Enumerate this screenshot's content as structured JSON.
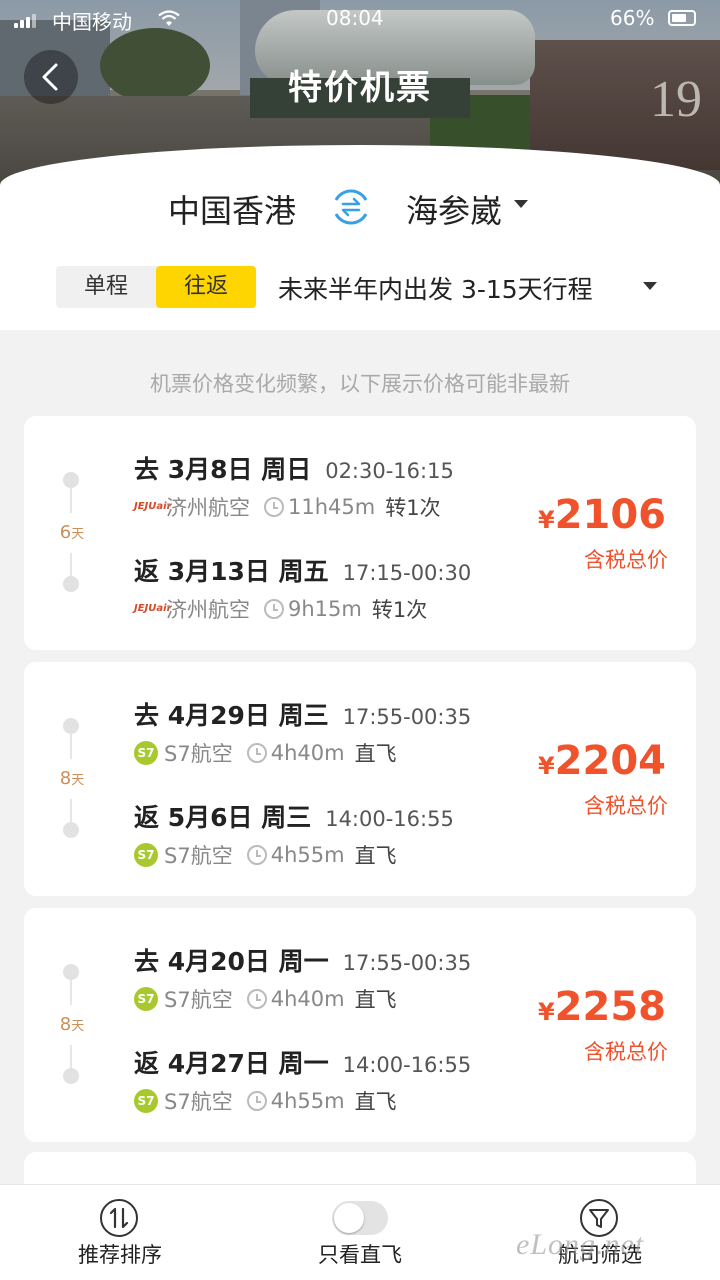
{
  "status_bar": {
    "carrier": "中国移动",
    "time": "08:04",
    "battery": "66%"
  },
  "header": {
    "title": "特价机票"
  },
  "route": {
    "from": "中国香港",
    "to": "海参崴"
  },
  "trip_type": {
    "one_way": "单程",
    "round_trip": "往返",
    "selected": "往返"
  },
  "date_filter": "未来半年内出发 3-15天行程",
  "notice": "机票价格变化频繁，以下展示价格可能非最新",
  "cards": [
    {
      "days": "6",
      "days_unit": "天",
      "out": {
        "date": "去 3月8日 周日",
        "time": "02:30-16:15",
        "airline": "济州航空",
        "logo": "JEJUair",
        "duration": "11h45m",
        "stops": "转1次"
      },
      "ret": {
        "date": "返 3月13日 周五",
        "time": "17:15-00:30",
        "airline": "济州航空",
        "logo": "JEJUair",
        "duration": "9h15m",
        "stops": "转1次"
      },
      "currency": "¥",
      "price": "2106",
      "price_note": "含税总价"
    },
    {
      "days": "8",
      "days_unit": "天",
      "out": {
        "date": "去 4月29日 周三",
        "time": "17:55-00:35",
        "airline": "S7航空",
        "logo": "S7",
        "duration": "4h40m",
        "stops": "直飞"
      },
      "ret": {
        "date": "返 5月6日 周三",
        "time": "14:00-16:55",
        "airline": "S7航空",
        "logo": "S7",
        "duration": "4h55m",
        "stops": "直飞"
      },
      "currency": "¥",
      "price": "2204",
      "price_note": "含税总价"
    },
    {
      "days": "8",
      "days_unit": "天",
      "out": {
        "date": "去 4月20日 周一",
        "time": "17:55-00:35",
        "airline": "S7航空",
        "logo": "S7",
        "duration": "4h40m",
        "stops": "直飞"
      },
      "ret": {
        "date": "返 4月27日 周一",
        "time": "14:00-16:55",
        "airline": "S7航空",
        "logo": "S7",
        "duration": "4h55m",
        "stops": "直飞"
      },
      "currency": "¥",
      "price": "2258",
      "price_note": "含税总价"
    }
  ],
  "bottom_bar": {
    "sort": "推荐排序",
    "direct_only": "只看直飞",
    "airline_filter": "航司筛选"
  },
  "watermark": "eLong.net",
  "colors": {
    "accent_yellow": "#ffd500",
    "price_red": "#f0522c",
    "s7_green": "#a8c92d"
  }
}
